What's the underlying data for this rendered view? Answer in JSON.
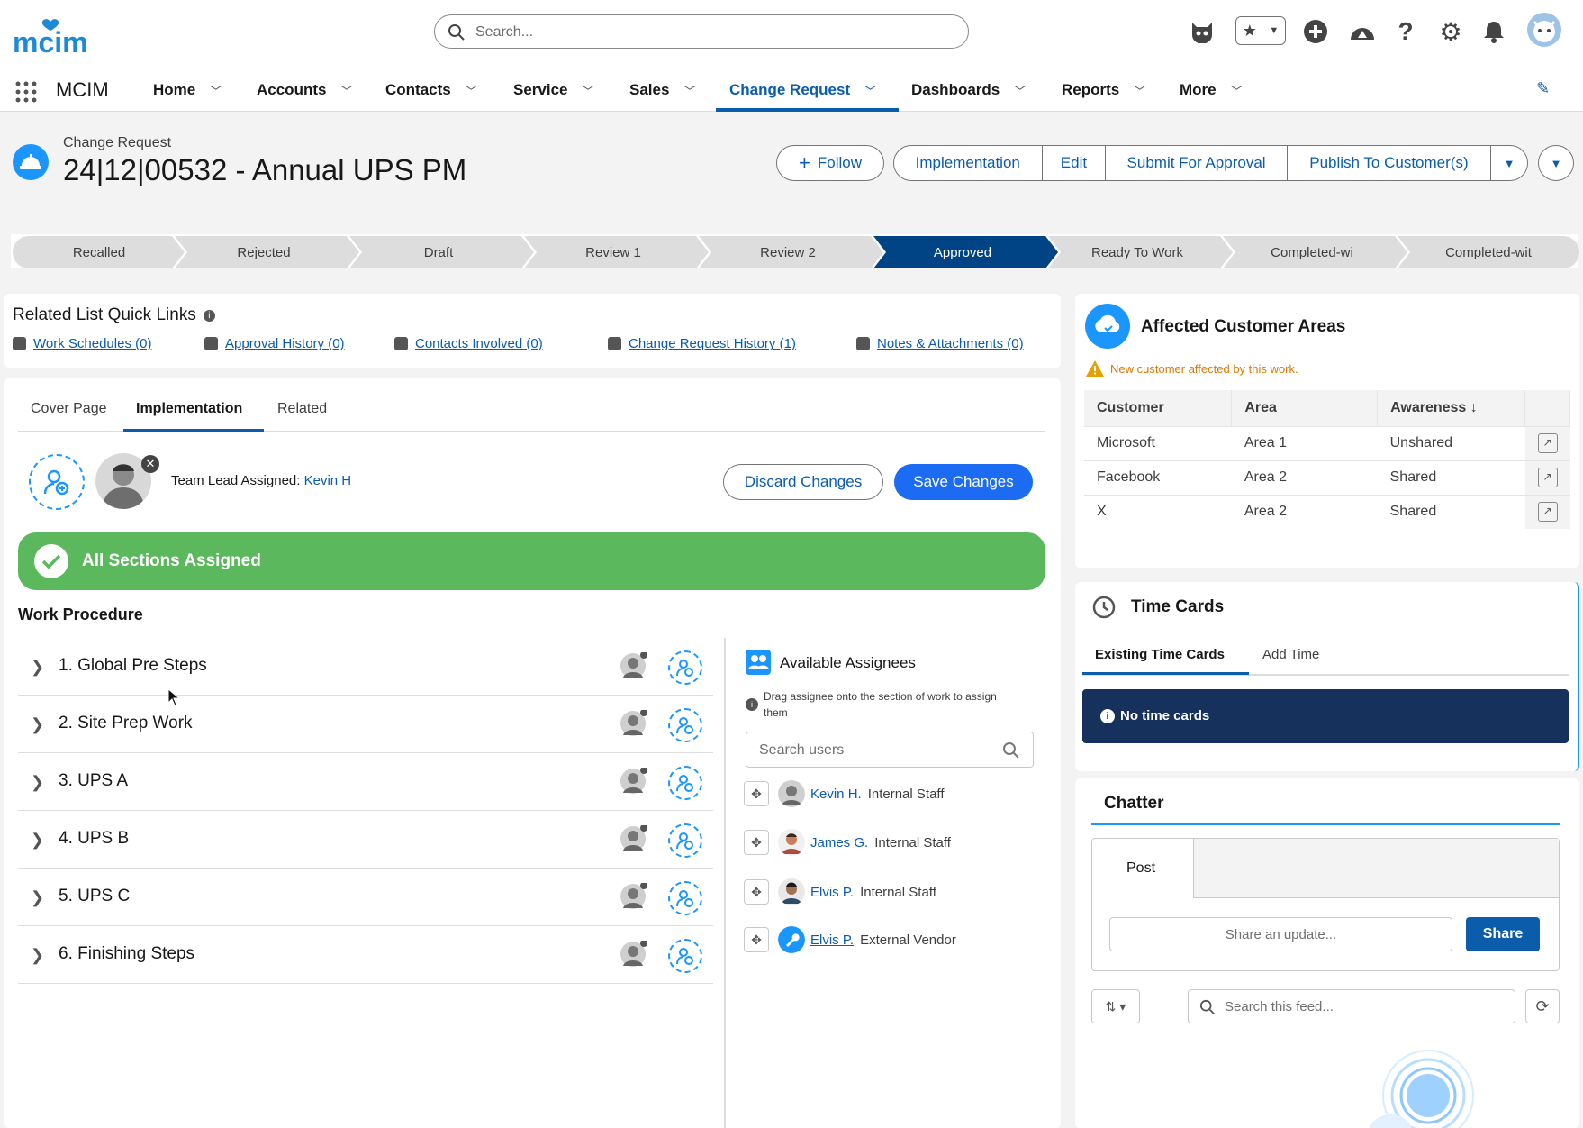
{
  "brand": {
    "logo_text": "mcim"
  },
  "search": {
    "placeholder": "Search..."
  },
  "nav": {
    "app_name": "MCIM",
    "items": [
      "Home",
      "Accounts",
      "Contacts",
      "Service",
      "Sales",
      "Change Request",
      "Dashboards",
      "Reports",
      "More"
    ],
    "active": "Change Request"
  },
  "header": {
    "object_label": "Change Request",
    "title": "24|12|00532 - Annual UPS PM",
    "follow_label": "Follow",
    "actions": [
      "Implementation",
      "Edit",
      "Submit For Approval",
      "Publish To Customer(s)"
    ]
  },
  "path": {
    "stages": [
      "Recalled",
      "Rejected",
      "Draft",
      "Review 1",
      "Review 2",
      "Approved",
      "Ready To Work",
      "Completed-wi",
      "Completed-wit"
    ],
    "current": "Approved"
  },
  "quick_links": {
    "title": "Related List Quick Links",
    "links": [
      "Work Schedules (0)",
      "Approval History (0)",
      "Contacts Involved (0)",
      "Change Request History (1)",
      "Notes & Attachments (0)"
    ]
  },
  "tabs": {
    "items": [
      "Cover Page",
      "Implementation",
      "Related"
    ],
    "active": "Implementation"
  },
  "team_lead": {
    "label": "Team Lead Assigned:",
    "name": "Kevin H"
  },
  "buttons": {
    "discard": "Discard Changes",
    "save": "Save Changes"
  },
  "banner": {
    "text": "All Sections Assigned",
    "color": "#5cb85c"
  },
  "work_procedure": {
    "title": "Work Procedure",
    "steps": [
      "1. Global Pre Steps",
      "2. Site Prep Work",
      "3. UPS A",
      "4. UPS B",
      "5. UPS C",
      "6. Finishing Steps"
    ]
  },
  "assignees": {
    "title": "Available Assignees",
    "hint": "Drag assignee onto the section of work to assign them",
    "search_placeholder": "Search users",
    "people": [
      {
        "name": "Kevin H.",
        "role": "Internal Staff"
      },
      {
        "name": "James G.",
        "role": "Internal Staff"
      },
      {
        "name": "Elvis P.",
        "role": "Internal Staff"
      },
      {
        "name": "Elvis P.",
        "role": "External Vendor"
      }
    ]
  },
  "affected": {
    "title": "Affected Customer Areas",
    "warning": "New customer affected by this work.",
    "columns": [
      "Customer",
      "Area",
      "Awareness ↓"
    ],
    "rows": [
      [
        "Microsoft",
        "Area 1",
        "Unshared"
      ],
      [
        "Facebook",
        "Area 2",
        "Shared"
      ],
      [
        "X",
        "Area 2",
        "Shared"
      ]
    ]
  },
  "time_cards": {
    "title": "Time Cards",
    "tabs": [
      "Existing Time Cards",
      "Add Time"
    ],
    "empty": "No time cards"
  },
  "chatter": {
    "title": "Chatter",
    "post_tab": "Post",
    "share_placeholder": "Share an update...",
    "share_label": "Share",
    "feed_search_placeholder": "Search this feed..."
  },
  "colors": {
    "brand_blue": "#0b5cab",
    "path_active": "#014486",
    "time_banner": "#16325c"
  }
}
